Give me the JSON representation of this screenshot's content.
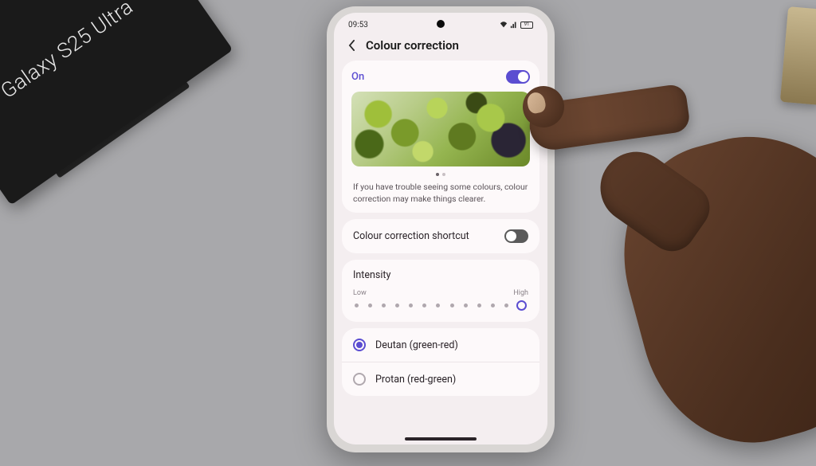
{
  "product_box": {
    "label": "Galaxy S25 Ultra"
  },
  "status": {
    "time": "09:53",
    "battery": "91"
  },
  "header": {
    "title": "Colour correction"
  },
  "main_toggle": {
    "label": "On",
    "state": true
  },
  "description": "If you have trouble seeing some colours, colour correction may make things clearer.",
  "shortcut": {
    "label": "Colour correction shortcut",
    "state": false
  },
  "intensity": {
    "title": "Intensity",
    "low": "Low",
    "high": "High"
  },
  "options": [
    {
      "label": "Deutan (green-red)",
      "selected": true
    },
    {
      "label": "Protan (red-green)",
      "selected": false
    }
  ]
}
